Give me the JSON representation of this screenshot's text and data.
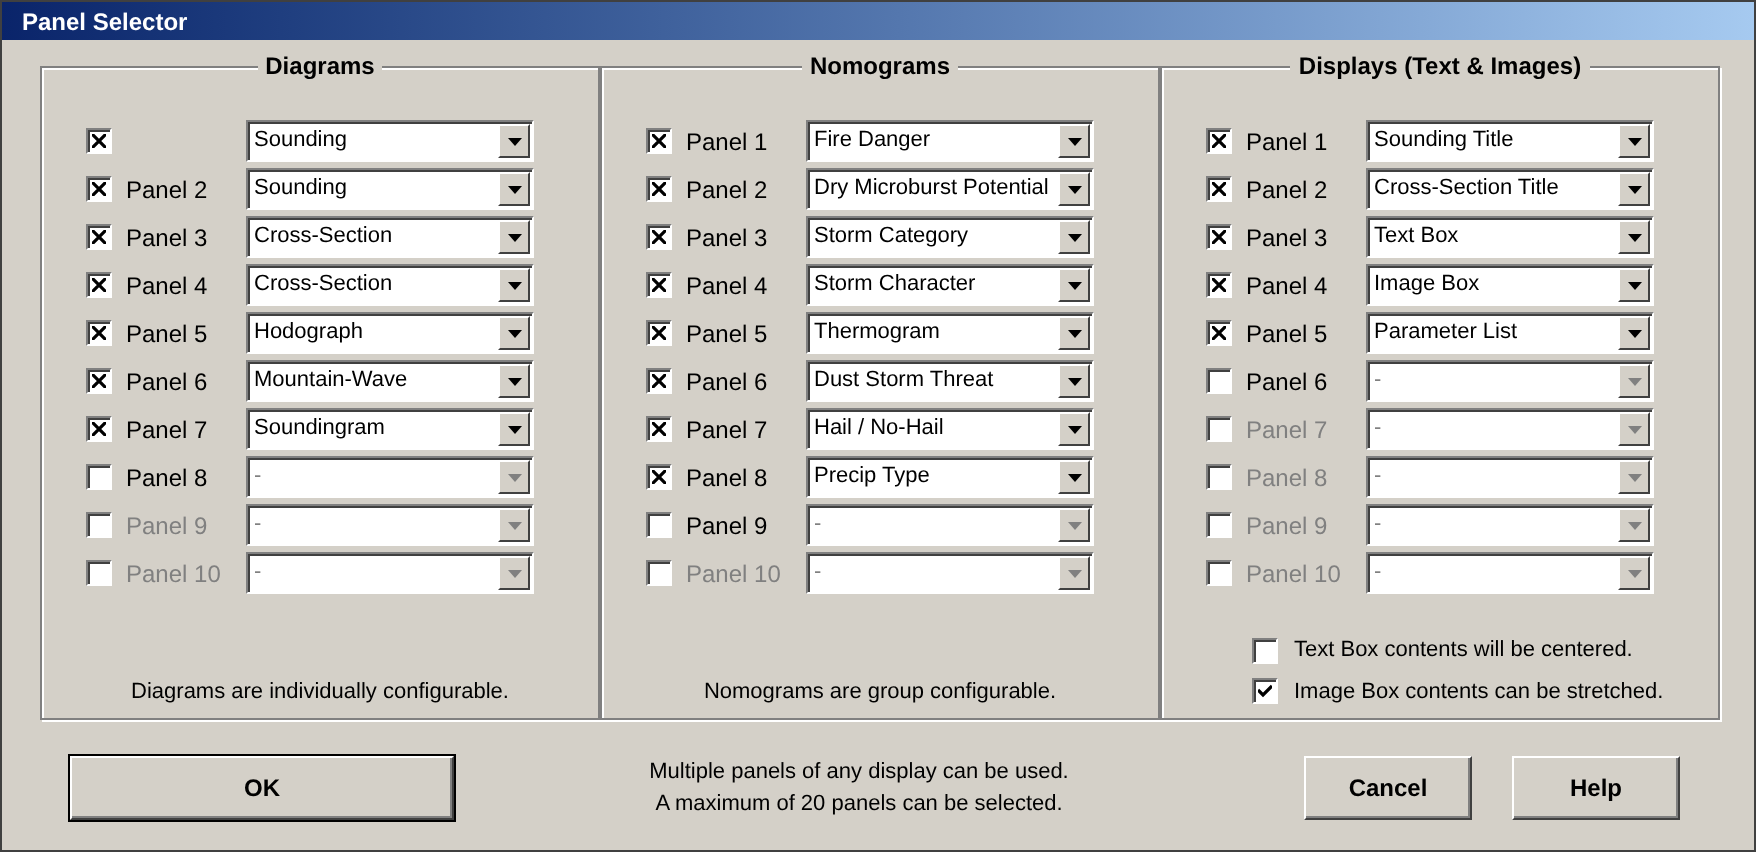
{
  "window": {
    "title": "Panel Selector"
  },
  "groups": [
    {
      "title": "Diagrams",
      "rows": [
        {
          "label": "",
          "checked": true,
          "disabled": false,
          "value": "Sounding"
        },
        {
          "label": "Panel 2",
          "checked": true,
          "disabled": false,
          "value": "Sounding"
        },
        {
          "label": "Panel 3",
          "checked": true,
          "disabled": false,
          "value": "Cross-Section"
        },
        {
          "label": "Panel 4",
          "checked": true,
          "disabled": false,
          "value": "Cross-Section"
        },
        {
          "label": "Panel 5",
          "checked": true,
          "disabled": false,
          "value": "Hodograph"
        },
        {
          "label": "Panel 6",
          "checked": true,
          "disabled": false,
          "value": "Mountain-Wave"
        },
        {
          "label": "Panel 7",
          "checked": true,
          "disabled": false,
          "value": "Soundingram"
        },
        {
          "label": "Panel 8",
          "checked": false,
          "disabled": false,
          "value": "-"
        },
        {
          "label": "Panel 9",
          "checked": false,
          "disabled": true,
          "value": "-"
        },
        {
          "label": "Panel 10",
          "checked": false,
          "disabled": true,
          "value": "-"
        }
      ],
      "note": "Diagrams are individually configurable."
    },
    {
      "title": "Nomograms",
      "rows": [
        {
          "label": "Panel 1",
          "checked": true,
          "disabled": false,
          "value": "Fire Danger"
        },
        {
          "label": "Panel 2",
          "checked": true,
          "disabled": false,
          "value": "Dry Microburst Potential"
        },
        {
          "label": "Panel 3",
          "checked": true,
          "disabled": false,
          "value": "Storm Category"
        },
        {
          "label": "Panel 4",
          "checked": true,
          "disabled": false,
          "value": "Storm Character"
        },
        {
          "label": "Panel 5",
          "checked": true,
          "disabled": false,
          "value": "Thermogram"
        },
        {
          "label": "Panel 6",
          "checked": true,
          "disabled": false,
          "value": "Dust Storm Threat"
        },
        {
          "label": "Panel 7",
          "checked": true,
          "disabled": false,
          "value": "Hail / No-Hail"
        },
        {
          "label": "Panel 8",
          "checked": true,
          "disabled": false,
          "value": "Precip Type"
        },
        {
          "label": "Panel 9",
          "checked": false,
          "disabled": false,
          "value": "-"
        },
        {
          "label": "Panel 10",
          "checked": false,
          "disabled": true,
          "value": "-"
        }
      ],
      "note": "Nomograms are group configurable."
    },
    {
      "title": "Displays (Text & Images)",
      "rows": [
        {
          "label": "Panel 1",
          "checked": true,
          "disabled": false,
          "value": "Sounding Title"
        },
        {
          "label": "Panel 2",
          "checked": true,
          "disabled": false,
          "value": "Cross-Section Title"
        },
        {
          "label": "Panel 3",
          "checked": true,
          "disabled": false,
          "value": "Text Box"
        },
        {
          "label": "Panel 4",
          "checked": true,
          "disabled": false,
          "value": "Image Box"
        },
        {
          "label": "Panel 5",
          "checked": true,
          "disabled": false,
          "value": "Parameter List"
        },
        {
          "label": "Panel 6",
          "checked": false,
          "disabled": false,
          "value": "-"
        },
        {
          "label": "Panel 7",
          "checked": false,
          "disabled": true,
          "value": "-"
        },
        {
          "label": "Panel 8",
          "checked": false,
          "disabled": true,
          "value": "-"
        },
        {
          "label": "Panel 9",
          "checked": false,
          "disabled": true,
          "value": "-"
        },
        {
          "label": "Panel 10",
          "checked": false,
          "disabled": true,
          "value": "-"
        }
      ],
      "options": [
        {
          "label": "Text Box contents will be centered.",
          "checked": false
        },
        {
          "label": "Image Box contents can be stretched.",
          "checked": true
        }
      ]
    }
  ],
  "footer": {
    "ok": "OK",
    "notes": [
      "Multiple panels of any display can be used.",
      "A maximum of 20 panels can be selected."
    ],
    "cancel": "Cancel",
    "help": "Help"
  }
}
